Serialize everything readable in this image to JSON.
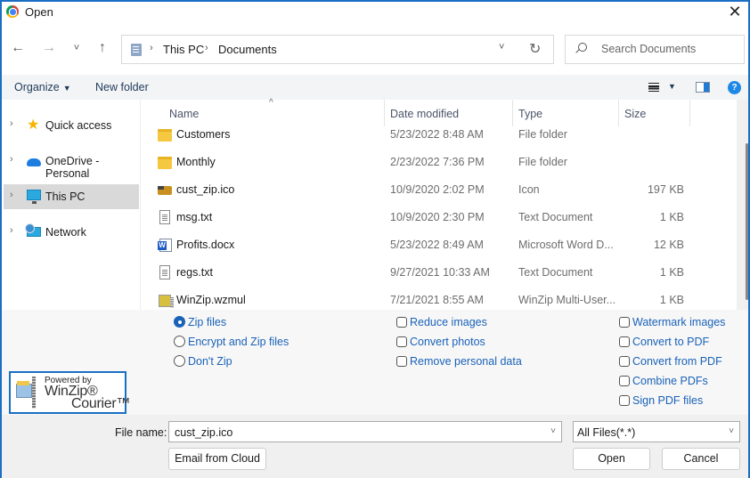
{
  "window": {
    "title": "Open",
    "close_glyph": "✕"
  },
  "nav": {
    "back_glyph": "←",
    "forward_glyph": "→",
    "recent_glyph": "˅",
    "up_glyph": "↑",
    "address": {
      "crumbs": [
        "This PC",
        "Documents"
      ],
      "separator": "›",
      "dropdown_glyph": "˅",
      "refresh_glyph": "↻"
    },
    "search": {
      "placeholder": "Search Documents"
    }
  },
  "toolbar": {
    "organize_label": "Organize",
    "caret": "▼",
    "new_folder_label": "New folder",
    "view_caret": "▼",
    "help_glyph": "?"
  },
  "sidebar": {
    "chevron": "›",
    "items": [
      {
        "label": "Quick access",
        "icon": "star-icon"
      },
      {
        "label": "OneDrive - Personal",
        "icon": "cloud-icon"
      },
      {
        "label": "This PC",
        "icon": "computer-icon",
        "selected": true
      },
      {
        "label": "Network",
        "icon": "network-icon"
      }
    ]
  },
  "filelist": {
    "sort_glyph": "^",
    "columns": {
      "name": "Name",
      "date": "Date modified",
      "type": "Type",
      "size": "Size"
    },
    "rows": [
      {
        "name": "Customers",
        "date": "5/23/2022 8:48 AM",
        "type": "File folder",
        "size": ""
      },
      {
        "name": "Monthly",
        "date": "2/23/2022 7:36 PM",
        "type": "File folder",
        "size": ""
      },
      {
        "name": "cust_zip.ico",
        "date": "10/9/2020 2:02 PM",
        "type": "Icon",
        "size": "197 KB"
      },
      {
        "name": "msg.txt",
        "date": "10/9/2020 2:30 PM",
        "type": "Text Document",
        "size": "1 KB"
      },
      {
        "name": "Profits.docx",
        "date": "5/23/2022 8:49 AM",
        "type": "Microsoft Word D...",
        "size": "12 KB"
      },
      {
        "name": "regs.txt",
        "date": "9/27/2021 10:33 AM",
        "type": "Text Document",
        "size": "1 KB"
      },
      {
        "name": "WinZip.wzmul",
        "date": "7/21/2021 8:55 AM",
        "type": "WinZip Multi-User...",
        "size": "1 KB"
      }
    ]
  },
  "options": {
    "zip_modes": [
      {
        "label": "Zip files",
        "selected": true
      },
      {
        "label": "Encrypt and Zip files",
        "selected": false
      },
      {
        "label": "Don't Zip",
        "selected": false
      }
    ],
    "image_actions": [
      {
        "label": "Reduce images",
        "checked": false
      },
      {
        "label": "Convert photos",
        "checked": false
      },
      {
        "label": "Remove personal data",
        "checked": false
      }
    ],
    "pdf_actions": [
      {
        "label": "Watermark images",
        "checked": false
      },
      {
        "label": "Convert to PDF",
        "checked": false
      },
      {
        "label": "Convert from PDF",
        "checked": false
      },
      {
        "label": "Combine PDFs",
        "checked": false
      },
      {
        "label": "Sign PDF files",
        "checked": false
      }
    ]
  },
  "logo": {
    "powered": "Powered by",
    "brand": "WinZip®",
    "product": "Courier™"
  },
  "bottom": {
    "file_name_label": "File name:",
    "file_name_value": "cust_zip.ico",
    "dropdown_glyph": "˅",
    "filter_value": "All Files(*.*)",
    "email_cloud_label": "Email from Cloud",
    "open_label": "Open",
    "cancel_label": "Cancel"
  },
  "colors": {
    "accent": "#1a6fc4",
    "link": "#1a62b8",
    "selected_bg": "#d9d9d9"
  }
}
